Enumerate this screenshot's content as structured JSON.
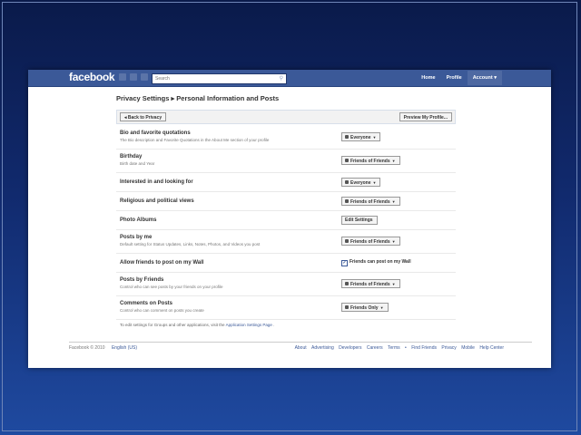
{
  "header": {
    "logo": "facebook",
    "search_placeholder": "Search",
    "nav": [
      "Home",
      "Profile",
      "Account ▾"
    ]
  },
  "page": {
    "title": "Privacy Settings ▸ Personal Information and Posts",
    "back_button": "◂ Back to Privacy",
    "preview_button": "Preview My Profile..."
  },
  "settings": [
    {
      "label": "Bio and favorite quotations",
      "desc": "The Bio description and Favorite Quotations in the About Me section of your profile",
      "control": "select",
      "value": "Everyone"
    },
    {
      "label": "Birthday",
      "desc": "Birth date and Year",
      "control": "select",
      "value": "Friends of Friends"
    },
    {
      "label": "Interested in and looking for",
      "desc": "",
      "control": "select",
      "value": "Everyone"
    },
    {
      "label": "Religious and political views",
      "desc": "",
      "control": "select",
      "value": "Friends of Friends"
    },
    {
      "label": "Photo Albums",
      "desc": "",
      "control": "button",
      "value": "Edit Settings"
    },
    {
      "label": "Posts by me",
      "desc": "Default setting for Status Updates, Links, Notes, Photos, and Videos you post",
      "control": "select",
      "value": "Friends of Friends"
    },
    {
      "label": "Allow friends to post on my Wall",
      "desc": "",
      "control": "checkbox",
      "value": "Friends can post on my Wall",
      "checked": true
    },
    {
      "label": "Posts by Friends",
      "desc": "Control who can see posts by your friends on your profile",
      "control": "select",
      "value": "Friends of Friends"
    },
    {
      "label": "Comments on Posts",
      "desc": "Control who can comment on posts you create",
      "control": "select",
      "value": "Friends Only"
    }
  ],
  "note": {
    "text": "To edit settings for Groups and other applications, visit the",
    "link": "Application Settings Page",
    "end": "."
  },
  "footer": {
    "copyright": "Facebook © 2010",
    "language": "English (US)",
    "links": [
      "About",
      "Advertising",
      "Developers",
      "Careers",
      "Terms",
      "•",
      "Find Friends",
      "Privacy",
      "Mobile",
      "Help Center"
    ]
  },
  "colors": {
    "brand": "#3b5998",
    "background": "#0a1a4a"
  }
}
